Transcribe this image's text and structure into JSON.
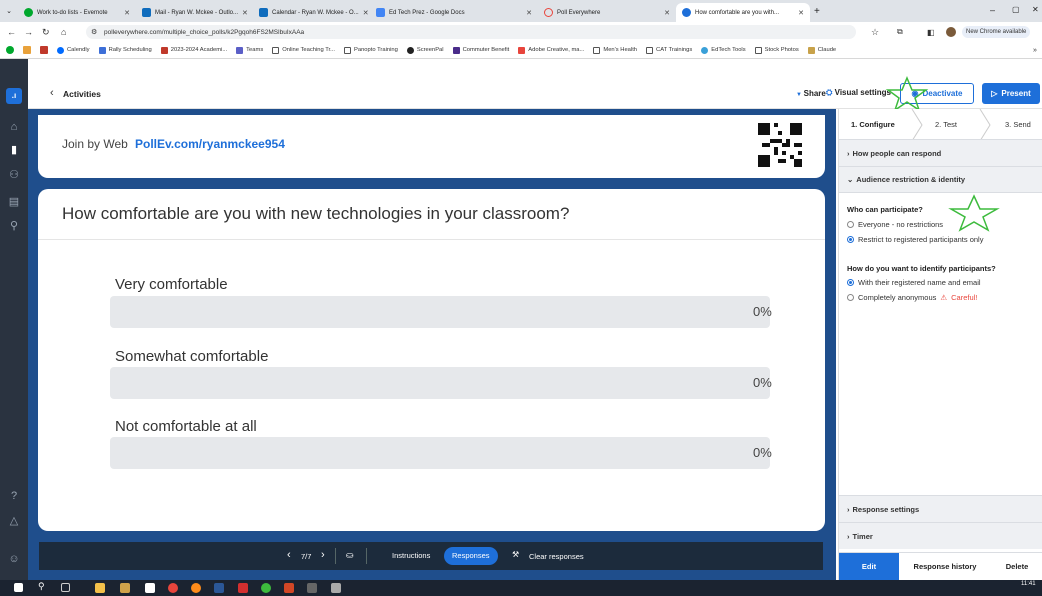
{
  "browser": {
    "tabs": [
      {
        "label": "Work to-do lists - Evernote",
        "color": "#00a82d"
      },
      {
        "label": "Mail - Ryan W. Mckee - Outlo...",
        "color": "#0f6cbd"
      },
      {
        "label": "Calendar - Ryan W. Mckee - O...",
        "color": "#0f6cbd"
      },
      {
        "label": "Ed Tech Prez - Google Docs",
        "color": "#4285f4"
      },
      {
        "label": "Poll Everywhere",
        "color": "#e8453c"
      },
      {
        "label": "How comfortable are you with...",
        "color": "#1e6fd9",
        "active": true
      }
    ],
    "new_tab": "+",
    "url": "polleverywhere.com/multiple_choice_polls/k2Pgqoh6FS2MSlbuIxAAa",
    "update_label": "New Chrome available",
    "bookmarks": [
      {
        "label": "Calendly",
        "color": "#006bff"
      },
      {
        "label": "Rally Scheduling",
        "color": "#3d6fd8"
      },
      {
        "label": "2023-2024 Academi...",
        "color": "#c0392b"
      },
      {
        "label": "Teams",
        "color": "#5b5fc7"
      },
      {
        "label": "Online Teaching Tr...",
        "color": "#777"
      },
      {
        "label": "Panopto Training",
        "color": "#777"
      },
      {
        "label": "ScreenPal",
        "color": "#222"
      },
      {
        "label": "Commuter Benefit",
        "color": "#4a2c8a"
      },
      {
        "label": "Adobe Creative, ma...",
        "color": "#e8453c"
      },
      {
        "label": "Men's Health",
        "color": "#777"
      },
      {
        "label": "CAT Trainings",
        "color": "#777"
      },
      {
        "label": "EdTech Tools",
        "color": "#777"
      },
      {
        "label": "Stock Photos",
        "color": "#777"
      },
      {
        "label": "Claude",
        "color": "#c8a24a"
      }
    ]
  },
  "header": {
    "back_label": "Activities",
    "share_label": "Share",
    "visual_settings_label": "Visual settings",
    "deactivate_label": "Deactivate",
    "present_label": "Present"
  },
  "poll": {
    "join_prefix": "Join by Web",
    "join_url": "PollEv.com/ryanmckee954",
    "question": "How comfortable are you with new technologies in your classroom?",
    "options": [
      {
        "label": "Very comfortable",
        "percent": "0%",
        "fraction": 0
      },
      {
        "label": "Somewhat comfortable",
        "percent": "0%",
        "fraction": 0
      },
      {
        "label": "Not comfortable at all",
        "percent": "0%",
        "fraction": 0
      }
    ]
  },
  "controls": {
    "counter": "7/7",
    "instructions_label": "Instructions",
    "responses_label": "Responses",
    "clear_label": "Clear responses"
  },
  "panel": {
    "steps": [
      "1. Configure",
      "2. Test",
      "3. Send"
    ],
    "how_respond": "How people can respond",
    "audience": "Audience restriction & identity",
    "who_label": "Who can participate?",
    "who_opt1": "Everyone - no restrictions",
    "who_opt2": "Restrict to registered participants only",
    "identify_label": "How do you want to identify participants?",
    "id_opt1": "With their registered name and email",
    "id_opt2": "Completely anonymous",
    "careful": "Careful!",
    "response_settings": "Response settings",
    "timer": "Timer",
    "footer": [
      "Edit",
      "Response history",
      "Delete"
    ]
  },
  "taskbar": {
    "time": "11:41"
  },
  "colors": {
    "accent": "#1e6fd9",
    "stage": "#1f4e8c",
    "nav": "#2a3340",
    "annotation": "#3dbb3d"
  }
}
